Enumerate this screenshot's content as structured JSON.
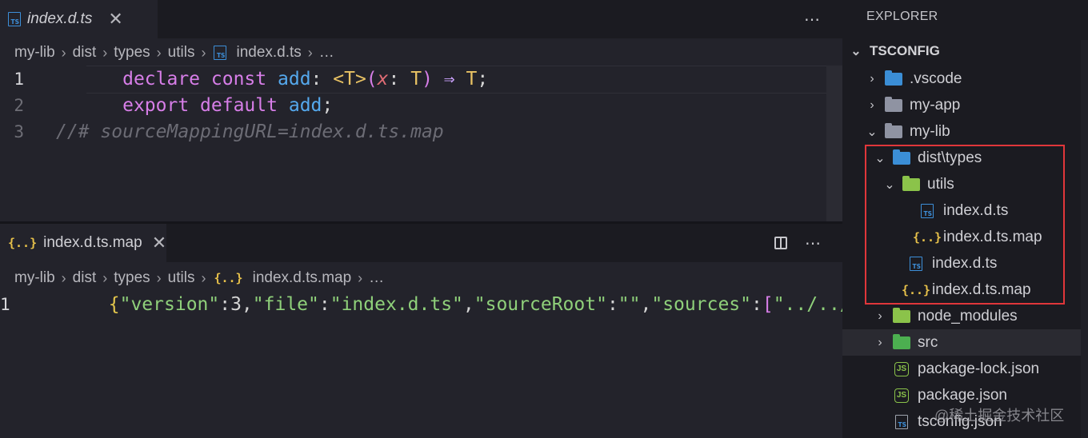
{
  "top_editor": {
    "tab": {
      "label": "index.d.ts",
      "icon": "typescript-file-icon"
    },
    "breadcrumb": [
      "my-lib",
      "dist",
      "types",
      "utils",
      "index.d.ts",
      "…"
    ],
    "lines": [
      {
        "num": "1",
        "tokens": {
          "t1": "declare",
          "t2": " ",
          "t3": "const",
          "t4": " ",
          "t5": "add",
          "t6": ": ",
          "t7": "<T>",
          "t8": "(",
          "t9": "x",
          "t10": ": ",
          "t11": "T",
          "t12": ") ",
          "t13": "⇒",
          "t14": " ",
          "t15": "T",
          "t16": ";"
        }
      },
      {
        "num": "2",
        "tokens": {
          "t1": "export",
          "t2": " ",
          "t3": "default",
          "t4": " ",
          "t5": "add",
          "t6": ";"
        }
      },
      {
        "num": "3",
        "text": "//# sourceMappingURL=index.d.ts.map"
      }
    ]
  },
  "bottom_editor": {
    "tab": {
      "label": "index.d.ts.map",
      "icon": "json-braces-icon"
    },
    "breadcrumb": [
      "my-lib",
      "dist",
      "types",
      "utils",
      "index.d.ts.map",
      "…"
    ],
    "line": {
      "num": "1",
      "tokens": {
        "a": "{",
        "b": "\"version\"",
        "c": ":3,",
        "d": "\"file\"",
        "e": ":",
        "f": "\"index.d.ts\"",
        "g": ",",
        "h": "\"sourceRoot\"",
        "i": ":",
        "j": "\"\"",
        "k": ",",
        "l": "\"sources\"",
        "m": ":",
        "n": "[",
        "o": "\"../../"
      }
    }
  },
  "explorer": {
    "title": "EXPLORER",
    "section": "TSCONFIG",
    "items": [
      {
        "label": ".vscode",
        "icon": "vscode-folder-icon"
      },
      {
        "label": "my-app",
        "icon": "folder-icon"
      },
      {
        "label": "my-lib",
        "icon": "folder-open-icon"
      },
      {
        "label": "dist\\types",
        "icon": "typescript-folder-icon"
      },
      {
        "label": "utils",
        "icon": "utils-folder-icon"
      },
      {
        "label": "index.d.ts",
        "icon": "typescript-file-icon"
      },
      {
        "label": "index.d.ts.map",
        "icon": "json-braces-icon"
      },
      {
        "label": "index.d.ts",
        "icon": "typescript-file-icon"
      },
      {
        "label": "index.d.ts.map",
        "icon": "json-braces-icon"
      },
      {
        "label": "node_modules",
        "icon": "node-modules-folder-icon"
      },
      {
        "label": "src",
        "icon": "src-folder-icon"
      },
      {
        "label": "package-lock.json",
        "icon": "nodejs-icon"
      },
      {
        "label": "package.json",
        "icon": "nodejs-icon"
      },
      {
        "label": "tsconfig.json",
        "icon": "tsconfig-icon"
      }
    ]
  },
  "watermark": "@稀土掘金技术社区",
  "colors": {
    "highlight_box": "#e0363a",
    "ts_blue": "#3d8fd9",
    "json_yellow": "#e6c04a"
  }
}
